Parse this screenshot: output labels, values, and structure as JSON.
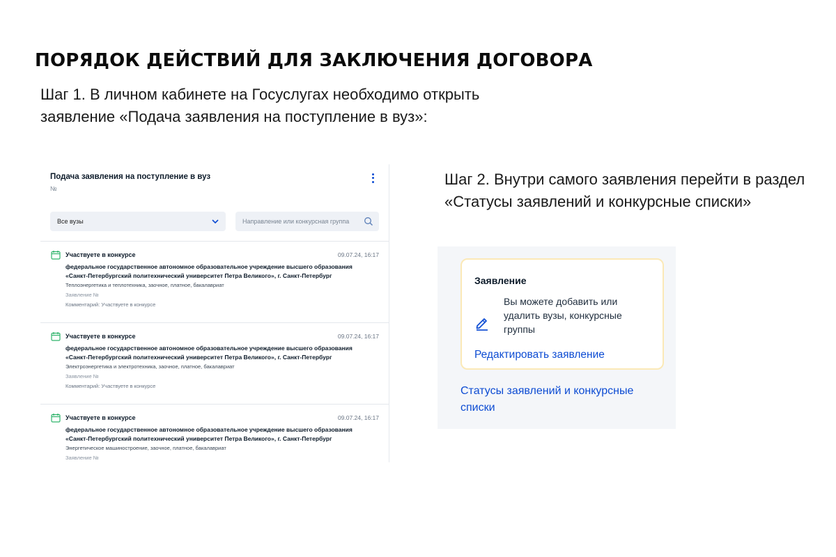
{
  "title": "ПОРЯДОК ДЕЙСТВИЙ ДЛЯ ЗАКЛЮЧЕНИЯ ДОГОВОРА",
  "step1": {
    "line1": "Шаг 1. В личном кабинете на Госуслугах необходимо открыть",
    "line2": "заявление «Подача заявления на поступление в вуз»:"
  },
  "step2": {
    "line1": "Шаг 2. Внутри самого заявления перейти в раздел",
    "line2": "«Статусы заявлений и конкурсные списки»"
  },
  "panel": {
    "title": "Подача заявления на поступление в вуз",
    "number": "№",
    "select_value": "Все вузы",
    "search_placeholder": "Направление или конкурсная группа",
    "items": [
      {
        "status": "Участвуете в конкурсе",
        "date": "09.07.24, 16:17",
        "org": "федеральное государственное автономное образовательное учреждение высшего образования «Санкт-Петербургский политехнический университет Петра Великого», г. Санкт-Петербург",
        "program": "Теплоэнергетика и теплотехника, заочное, платное, бакалавриат",
        "application": "Заявление №",
        "comment": "Комментарий: Участвуете в конкурсе"
      },
      {
        "status": "Участвуете в конкурсе",
        "date": "09.07.24, 16:17",
        "org": "федеральное государственное автономное образовательное учреждение высшего образования «Санкт-Петербургский политехнический университет Петра Великого», г. Санкт-Петербург",
        "program": "Электроэнергетика и электротехника, заочное, платное, бакалавриат",
        "application": "Заявление №",
        "comment": "Комментарий: Участвуете в конкурсе"
      },
      {
        "status": "Участвуете в конкурсе",
        "date": "09.07.24, 16:17",
        "org": "федеральное государственное автономное образовательное учреждение высшего образования «Санкт-Петербургский политехнический университет Петра Великого», г. Санкт-Петербург",
        "program": "Энергетическое машиностроение, заочное, платное, бакалавриат",
        "application": "Заявление №",
        "comment": ""
      }
    ]
  },
  "card": {
    "title": "Заявление",
    "description": "Вы можете добавить или удалить вузы, конкурсные группы",
    "edit_link": "Редактировать заявление",
    "status_link": "Статусы заявлений и конкурсные списки"
  },
  "colors": {
    "link_blue": "#0d4cd3",
    "calendar_green": "#2fb36b",
    "card_border": "#fbe9b7"
  },
  "icons": [
    "kebab-menu-icon",
    "chevron-down-icon",
    "search-icon",
    "calendar-icon",
    "pencil-icon"
  ]
}
